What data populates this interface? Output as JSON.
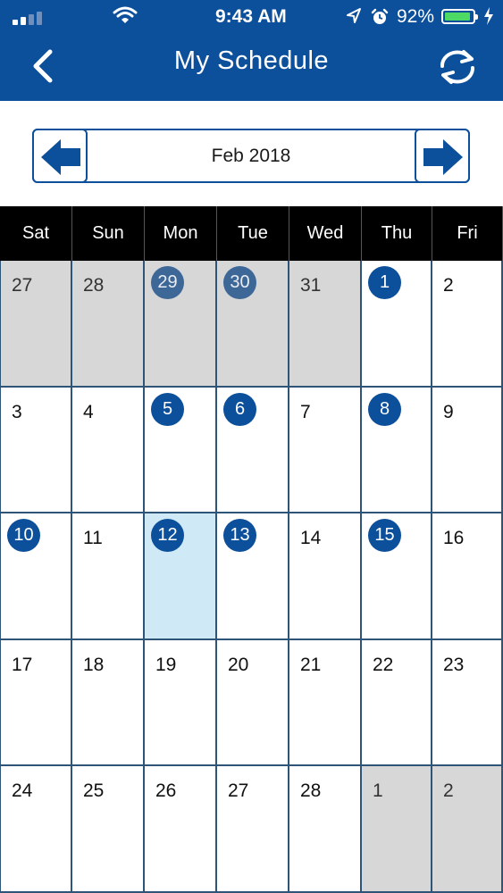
{
  "status_bar": {
    "time": "9:43 AM",
    "battery_percent": "92%",
    "battery_level": 0.92,
    "signal_bars": 2,
    "icons": [
      "signal-icon",
      "wifi-icon",
      "location-icon",
      "alarm-icon",
      "battery-icon",
      "charging-icon"
    ]
  },
  "header": {
    "title": "My Schedule",
    "back_icon": "chevron-left-icon",
    "refresh_icon": "refresh-icon",
    "background": "#0c4f9b"
  },
  "month_nav": {
    "label": "Feb 2018",
    "prev_icon": "arrow-left-icon",
    "next_icon": "arrow-right-icon"
  },
  "calendar": {
    "weekdays": [
      "Sat",
      "Sun",
      "Mon",
      "Tue",
      "Wed",
      "Thu",
      "Fri"
    ],
    "weeks": [
      [
        {
          "day": "27",
          "out": true,
          "event": false,
          "today": false
        },
        {
          "day": "28",
          "out": true,
          "event": false,
          "today": false
        },
        {
          "day": "29",
          "out": true,
          "event": true,
          "today": false
        },
        {
          "day": "30",
          "out": true,
          "event": true,
          "today": false
        },
        {
          "day": "31",
          "out": true,
          "event": false,
          "today": false
        },
        {
          "day": "1",
          "out": false,
          "event": true,
          "today": false
        },
        {
          "day": "2",
          "out": false,
          "event": false,
          "today": false
        }
      ],
      [
        {
          "day": "3",
          "out": false,
          "event": false,
          "today": false
        },
        {
          "day": "4",
          "out": false,
          "event": false,
          "today": false
        },
        {
          "day": "5",
          "out": false,
          "event": true,
          "today": false
        },
        {
          "day": "6",
          "out": false,
          "event": true,
          "today": false
        },
        {
          "day": "7",
          "out": false,
          "event": false,
          "today": false
        },
        {
          "day": "8",
          "out": false,
          "event": true,
          "today": false
        },
        {
          "day": "9",
          "out": false,
          "event": false,
          "today": false
        }
      ],
      [
        {
          "day": "10",
          "out": false,
          "event": true,
          "today": false
        },
        {
          "day": "11",
          "out": false,
          "event": false,
          "today": false
        },
        {
          "day": "12",
          "out": false,
          "event": true,
          "today": true
        },
        {
          "day": "13",
          "out": false,
          "event": true,
          "today": false
        },
        {
          "day": "14",
          "out": false,
          "event": false,
          "today": false
        },
        {
          "day": "15",
          "out": false,
          "event": true,
          "today": false
        },
        {
          "day": "16",
          "out": false,
          "event": false,
          "today": false
        }
      ],
      [
        {
          "day": "17",
          "out": false,
          "event": false,
          "today": false
        },
        {
          "day": "18",
          "out": false,
          "event": false,
          "today": false
        },
        {
          "day": "19",
          "out": false,
          "event": false,
          "today": false
        },
        {
          "day": "20",
          "out": false,
          "event": false,
          "today": false
        },
        {
          "day": "21",
          "out": false,
          "event": false,
          "today": false
        },
        {
          "day": "22",
          "out": false,
          "event": false,
          "today": false
        },
        {
          "day": "23",
          "out": false,
          "event": false,
          "today": false
        }
      ],
      [
        {
          "day": "24",
          "out": false,
          "event": false,
          "today": false
        },
        {
          "day": "25",
          "out": false,
          "event": false,
          "today": false
        },
        {
          "day": "26",
          "out": false,
          "event": false,
          "today": false
        },
        {
          "day": "27",
          "out": false,
          "event": false,
          "today": false
        },
        {
          "day": "28",
          "out": false,
          "event": false,
          "today": false
        },
        {
          "day": "1",
          "out": true,
          "event": false,
          "today": false
        },
        {
          "day": "2",
          "out": true,
          "event": false,
          "today": false
        }
      ]
    ],
    "colors": {
      "event_badge": "#0c4f9b",
      "out_of_month": "#d7d7d7",
      "today": "#cfe9f7",
      "grid_line": "#2e5578"
    }
  }
}
